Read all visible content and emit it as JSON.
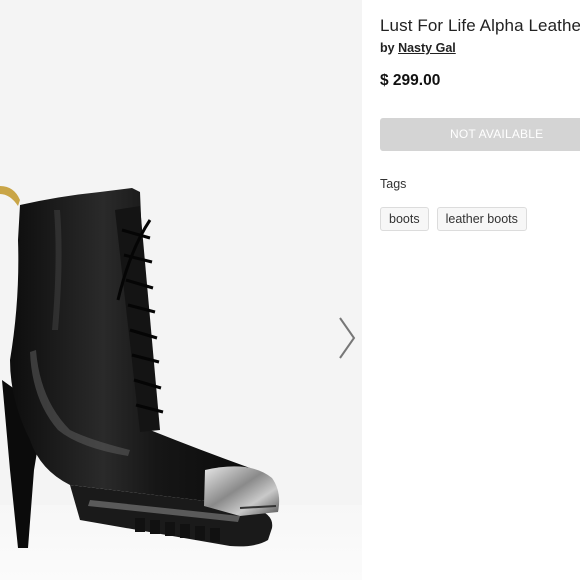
{
  "product": {
    "title": "Lust For Life Alpha Leather",
    "by_prefix": "by",
    "brand": "Nasty Gal",
    "price": "$ 299.00",
    "availability_button": "NOT AVAILABLE",
    "image_icon": "boot-product-image"
  },
  "gallery": {
    "next_icon": "chevron-right-icon"
  },
  "tags": {
    "label": "Tags",
    "items": [
      "boots",
      "leather boots"
    ]
  },
  "colors": {
    "button_disabled": "#d4d4d4",
    "image_background": "#f4f4f4",
    "tag_border": "#dcdcdc"
  }
}
